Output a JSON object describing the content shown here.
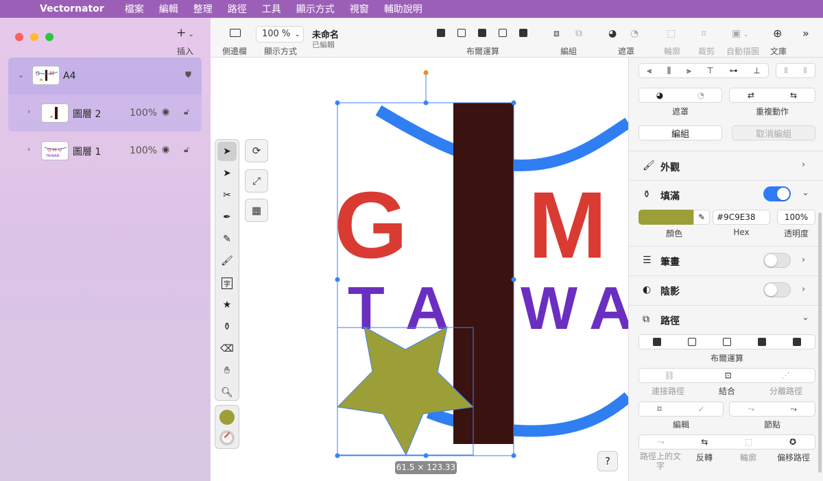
{
  "menubar": {
    "app": "Vectornator",
    "items": [
      "檔案",
      "編輯",
      "整理",
      "路徑",
      "工具",
      "顯示方式",
      "視窗",
      "輔助說明"
    ]
  },
  "sidebar": {
    "insert_label": "插入",
    "layers": [
      {
        "name": "A4",
        "percent": "",
        "expanded": true
      },
      {
        "name": "圖層 2",
        "percent": "100%"
      },
      {
        "name": "圖層 1",
        "percent": "100%"
      }
    ]
  },
  "toolbar": {
    "sidebar_label": "側邊欄",
    "zoom_value": "100 %",
    "view_label": "顯示方式",
    "doc_title": "未命名",
    "doc_status": "已編輯",
    "boolean_label": "布爾運算",
    "group_label": "編組",
    "mask_label": "遮罩",
    "outline_label": "輪廓",
    "crop_label": "裁剪",
    "autotrace_label": "自動描圖",
    "library_label": "文庫"
  },
  "canvas": {
    "letters_top": [
      "G",
      "M"
    ],
    "letters_bottom": [
      "T",
      "A",
      "W",
      "A"
    ],
    "selection_size": "61.5 × 123.33",
    "help_label": "?",
    "colors": {
      "red": "#D93B32",
      "purple": "#6A2FC0",
      "blue": "#2F7FF2",
      "rect": "#3A1210",
      "star": "#9C9E38"
    }
  },
  "inspector": {
    "mask_caption": "遮罩",
    "repeat_caption": "重複動作",
    "group_button": "編組",
    "ungroup_button": "取消編組",
    "appearance": "外觀",
    "fill": "填滿",
    "fill_enabled": true,
    "color_caption": "顏色",
    "hex_value": "#9C9E38",
    "hex_caption": "Hex",
    "opacity_value": "100%",
    "opacity_caption": "透明度",
    "stroke": "筆畫",
    "stroke_enabled": false,
    "shadow": "陰影",
    "shadow_enabled": false,
    "path": "路徑",
    "boolean_caption": "布爾運算",
    "join_path": "連接路徑",
    "combine": "結合",
    "separate_path": "分離路徑",
    "edit": "編輯",
    "nodes": "節點",
    "text_on_path": "路徑上的文字",
    "reverse": "反轉",
    "outline": "輪廓",
    "offset_path": "偏移路徑"
  }
}
